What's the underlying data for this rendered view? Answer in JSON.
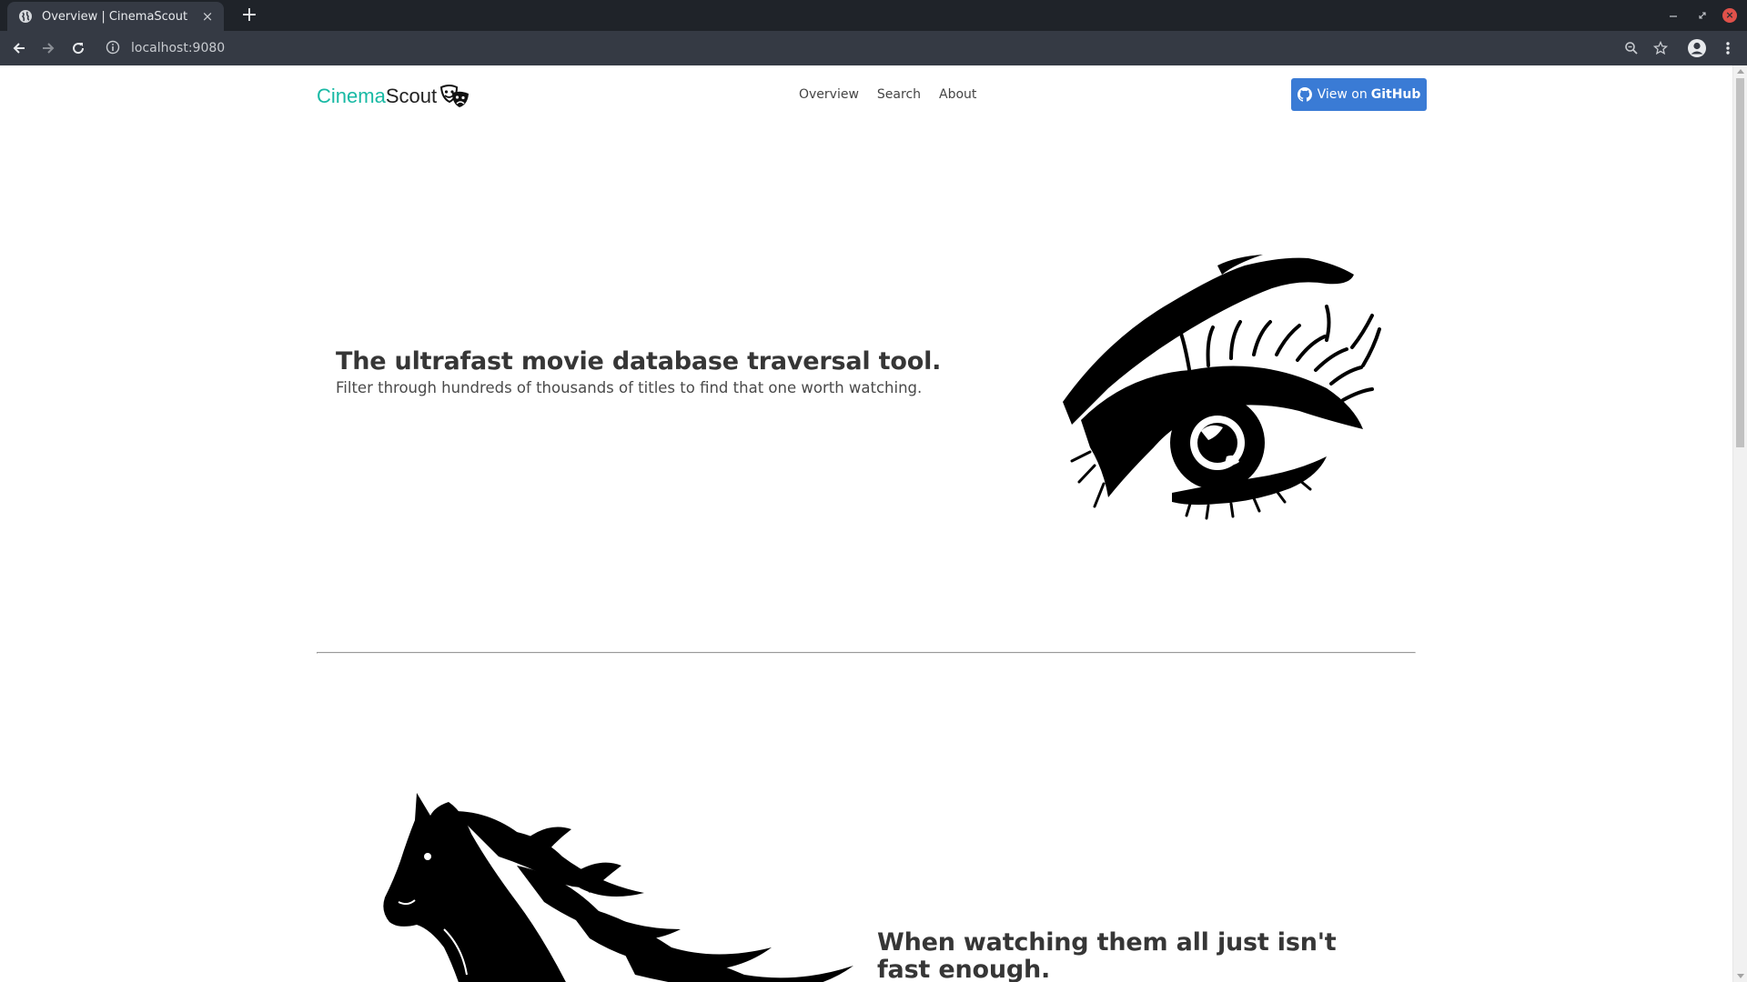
{
  "browser": {
    "tab_title": "Overview | CinemaScout",
    "tab_close": "×",
    "new_tab": "+",
    "url": "localhost:9080"
  },
  "navbar": {
    "brand_part1": "Cinema",
    "brand_part2": "Scout",
    "links": [
      "Overview",
      "Search",
      "About"
    ],
    "github_label_prefix": "View on",
    "github_label_strong": "GitHub"
  },
  "hero": {
    "title": "The ultrafast movie database traversal tool.",
    "subtitle": "Filter through hundreds of thousands of titles to find that one worth watching."
  },
  "section2": {
    "title": "When watching them all just isn't fast enough."
  },
  "colors": {
    "brand_accent": "#18b9a4",
    "button_blue": "#3a7bd5",
    "chrome_dark": "#1f2329",
    "chrome_toolbar": "#353a44"
  },
  "icons": {
    "tab_favicon": "globe-icon",
    "back": "arrow-left-icon",
    "forward": "arrow-right-icon",
    "reload": "reload-icon",
    "site_info": "info-icon",
    "zoom": "magnifier-icon",
    "bookmark": "star-icon",
    "profile": "account-icon",
    "menu": "kebab-menu-icon",
    "brand": "theater-masks-icon",
    "github": "github-icon"
  }
}
